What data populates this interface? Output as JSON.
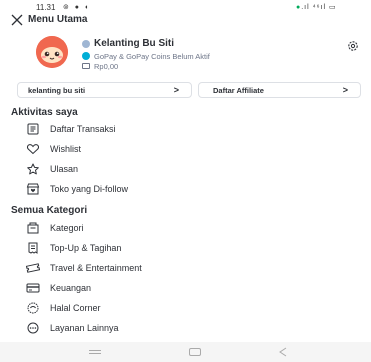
{
  "status_bar": {
    "time": "11.31",
    "left_icons": "⊚ ● ◐",
    "right_icons": ".ıl ⁴⁶ıl ▭"
  },
  "header": {
    "title": "Menu Utama",
    "close_icon": "close-icon"
  },
  "profile": {
    "name": "Kelanting Bu Siti",
    "gopay_text": "GoPay & GoPay Coins Belum Aktif",
    "balance": "Rp0,00",
    "avatar_color": "#f0684f",
    "gopay_color": "#00aed6"
  },
  "shortcuts": [
    {
      "label": "kelanting bu siti",
      "chevron": ">"
    },
    {
      "label": "Daftar Affiliate",
      "chevron": ">"
    }
  ],
  "sections": {
    "activity": {
      "title": "Aktivitas saya",
      "items": [
        {
          "label": "Daftar Transaksi",
          "icon": "receipt-icon"
        },
        {
          "label": "Wishlist",
          "icon": "heart-icon"
        },
        {
          "label": "Ulasan",
          "icon": "star-icon"
        },
        {
          "label": "Toko yang Di-follow",
          "icon": "followed-store-icon"
        }
      ]
    },
    "categories": {
      "title": "Semua Kategori",
      "items": [
        {
          "label": "Kategori",
          "icon": "category-icon"
        },
        {
          "label": "Top-Up & Tagihan",
          "icon": "bill-icon"
        },
        {
          "label": "Travel & Entertainment",
          "icon": "ticket-icon"
        },
        {
          "label": "Keuangan",
          "icon": "finance-icon"
        },
        {
          "label": "Halal Corner",
          "icon": "halal-icon"
        },
        {
          "label": "Layanan Lainnya",
          "icon": "more-services-icon"
        }
      ]
    }
  },
  "colors": {
    "text": "#2e3137",
    "muted": "#6d7588",
    "brand_green": "#00aa5b"
  }
}
